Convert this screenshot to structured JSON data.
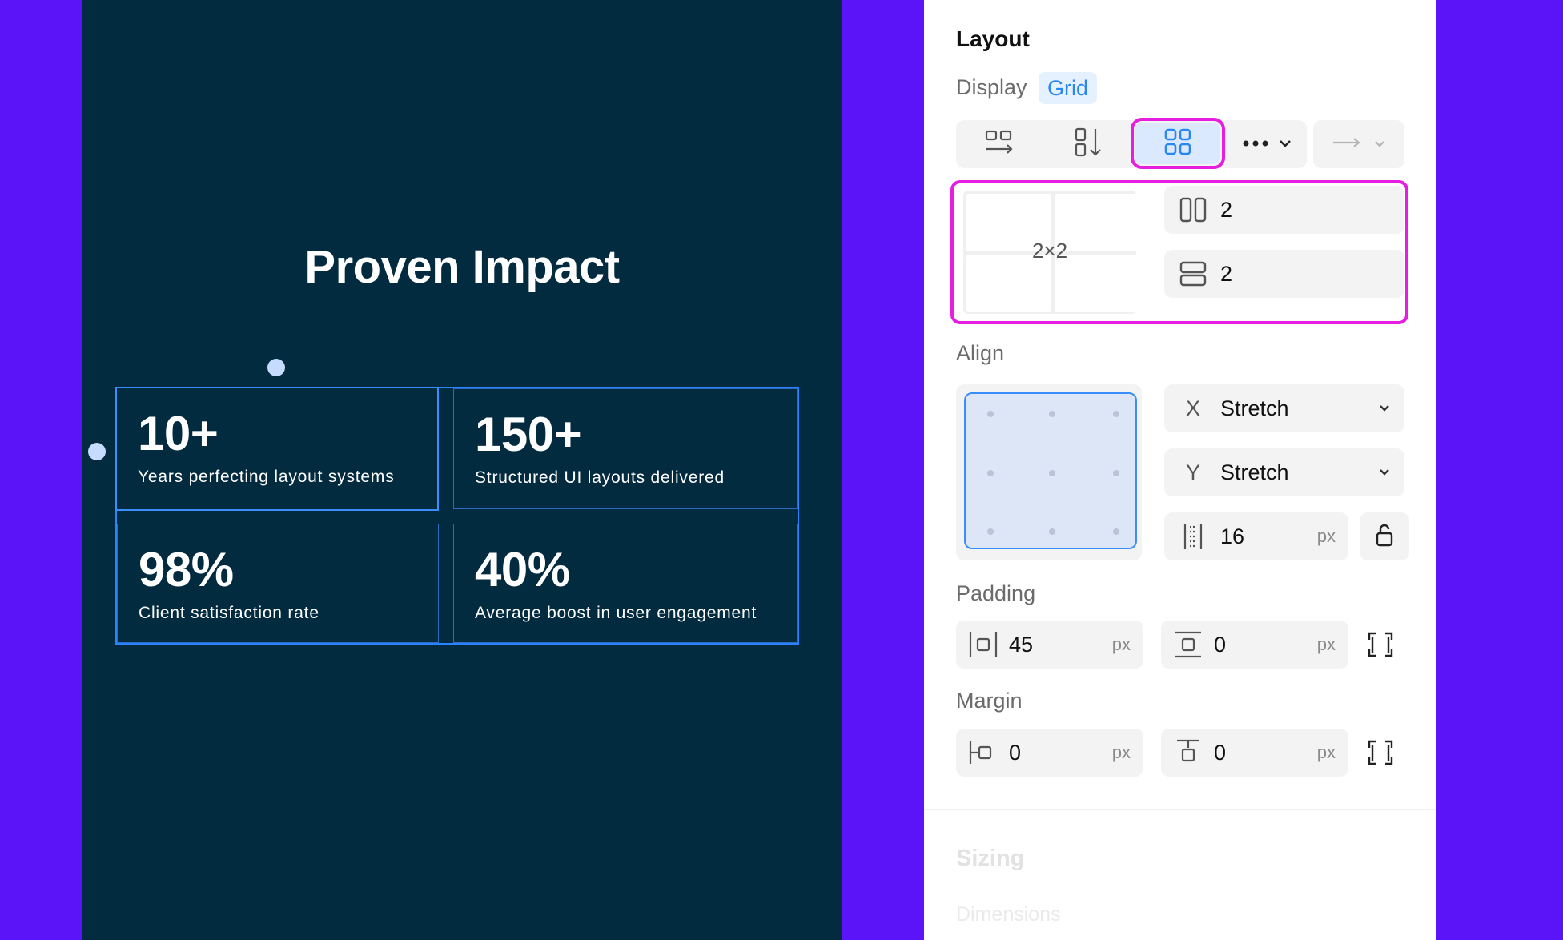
{
  "canvas": {
    "title": "Proven Impact",
    "stats": [
      {
        "value": "10+",
        "label": "Years perfecting layout systems"
      },
      {
        "value": "150+",
        "label": "Structured UI layouts delivered"
      },
      {
        "value": "98%",
        "label": "Client satisfaction rate"
      },
      {
        "value": "40%",
        "label": "Average boost in user engagement"
      }
    ]
  },
  "panel": {
    "section_title": "Layout",
    "display_label": "Display",
    "display_value": "Grid",
    "grid_preview_label": "2×2",
    "columns": "2",
    "rows": "2",
    "align_label": "Align",
    "align_x_axis": "X",
    "align_x_value": "Stretch",
    "align_y_axis": "Y",
    "align_y_value": "Stretch",
    "gap_value": "16",
    "unit": "px",
    "padding_label": "Padding",
    "padding_horizontal": "45",
    "padding_vertical": "0",
    "margin_label": "Margin",
    "margin_horizontal": "0",
    "margin_vertical": "0",
    "sizing_label": "Sizing",
    "dimensions_label": "Dimensions"
  },
  "colors": {
    "background": "#5b14f7",
    "canvas": "#022b40",
    "selection": "#2b84ff",
    "highlight": "#e51ee0",
    "accent": "#2a86f0"
  }
}
